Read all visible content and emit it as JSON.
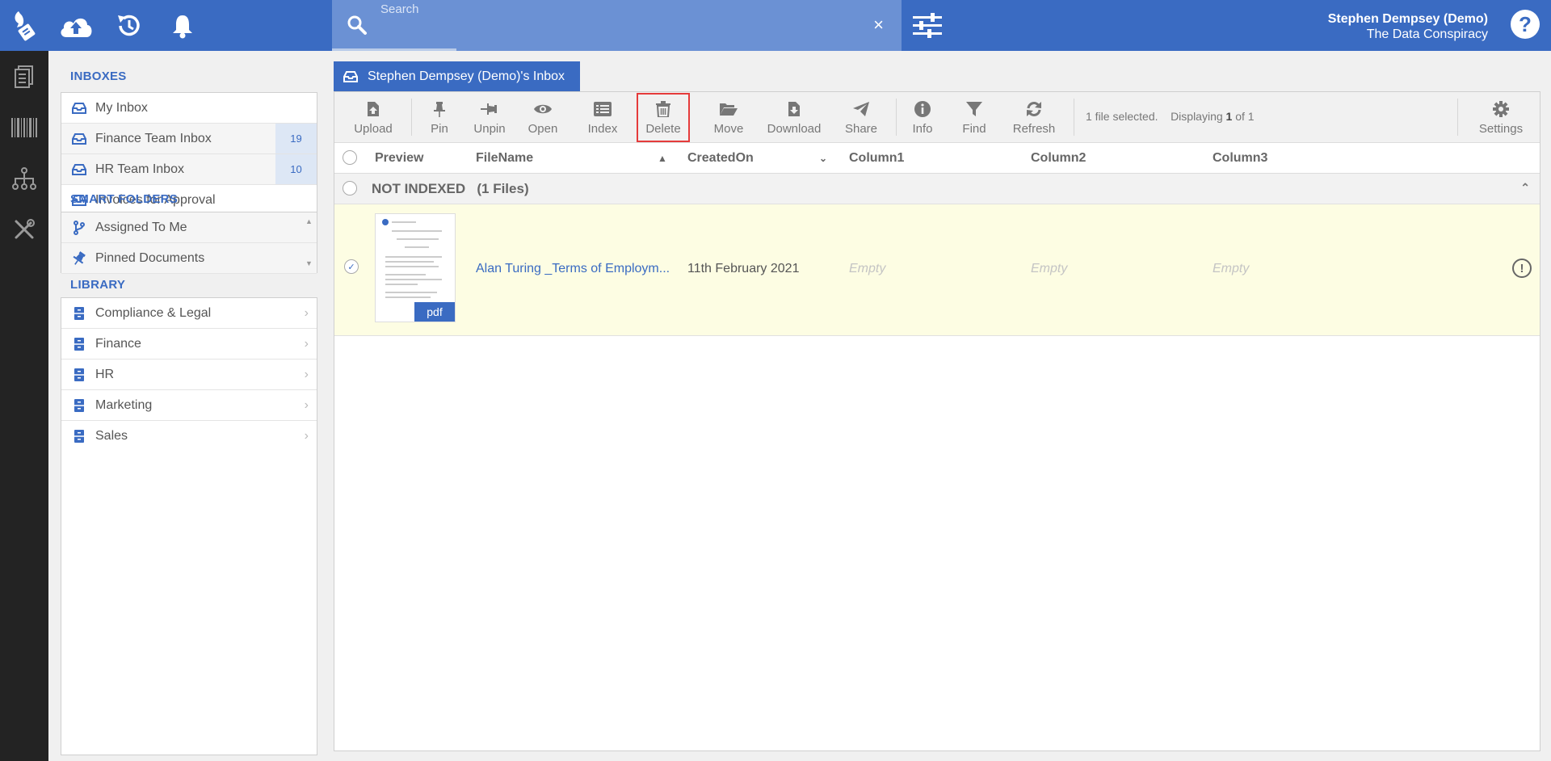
{
  "topbar": {
    "search_placeholder": "Search",
    "clear_label": "×",
    "user_name": "Stephen Dempsey (Demo)",
    "org_name": "The Data Conspiracy",
    "help_label": "?"
  },
  "sidebar": {
    "inboxes_title": "INBOXES",
    "inboxes": [
      {
        "label": "My Inbox",
        "count": ""
      },
      {
        "label": "Finance Team Inbox",
        "count": "19"
      },
      {
        "label": "HR Team Inbox",
        "count": "10"
      },
      {
        "label": "Invoices for Approval",
        "count": ""
      }
    ],
    "smart_title": "SMART FOLDERS",
    "smart_folders": [
      {
        "label": "Assigned To Me"
      },
      {
        "label": "Pinned Documents"
      }
    ],
    "library_title": "LIBRARY",
    "library": [
      {
        "label": "Compliance & Legal"
      },
      {
        "label": "Finance"
      },
      {
        "label": "HR"
      },
      {
        "label": "Marketing"
      },
      {
        "label": "Sales"
      }
    ]
  },
  "main": {
    "tab_label": "Stephen Dempsey (Demo)'s Inbox",
    "toolbar": {
      "upload": "Upload",
      "pin": "Pin",
      "unpin": "Unpin",
      "open": "Open",
      "index": "Index",
      "delete": "Delete",
      "move": "Move",
      "download": "Download",
      "share": "Share",
      "info": "Info",
      "find": "Find",
      "refresh": "Refresh",
      "settings": "Settings",
      "status_selected": "1 file selected.",
      "status_displaying_prefix": "Displaying",
      "status_displaying_current": "1",
      "status_displaying_suffix": "of 1"
    },
    "columns": {
      "preview": "Preview",
      "filename": "FileName",
      "createdon": "CreatedOn",
      "col1": "Column1",
      "col2": "Column2",
      "col3": "Column3"
    },
    "group": {
      "label": "NOT INDEXED",
      "count": "(1 Files)"
    },
    "row": {
      "filename": "Alan Turing _Terms of Employm...",
      "created": "11th February 2021",
      "col1": "Empty",
      "col2": "Empty",
      "col3": "Empty",
      "file_type": "pdf"
    }
  },
  "colors": {
    "brand": "#3a6bc2",
    "rail": "#232323",
    "highlight": "#e53b3b",
    "selected_row": "#fdfde3"
  }
}
